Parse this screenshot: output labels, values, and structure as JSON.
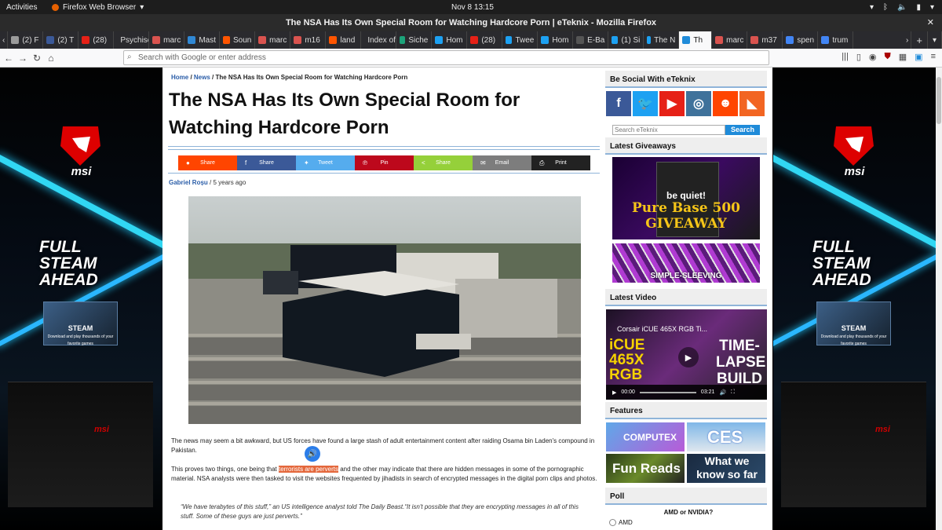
{
  "system_bar": {
    "activities": "Activities",
    "app_menu": "Firefox Web Browser",
    "clock": "Nov 8  13:15"
  },
  "window": {
    "title": "The NSA Has Its Own Special Room for Watching Hardcore Porn | eTeknix - Mozilla Firefox"
  },
  "tabs": [
    {
      "label": "(2) F",
      "color": "#9b9b9b"
    },
    {
      "label": "(2) T",
      "color": "#3b5998"
    },
    {
      "label": "(28)",
      "color": "#e62117"
    },
    {
      "label": "Psychisc",
      "color": "#777777"
    },
    {
      "label": "marc",
      "color": "#d9534f"
    },
    {
      "label": "Mast",
      "color": "#3088d4"
    },
    {
      "label": "Soun",
      "color": "#ff5500"
    },
    {
      "label": "marc",
      "color": "#d9534f"
    },
    {
      "label": "m16",
      "color": "#d9534f"
    },
    {
      "label": "land",
      "color": "#ff5500"
    },
    {
      "label": "Index of",
      "color": "#777777"
    },
    {
      "label": "Siche",
      "color": "#1ca37a"
    },
    {
      "label": "Hom",
      "color": "#1da1f2"
    },
    {
      "label": "(28)",
      "color": "#e62117"
    },
    {
      "label": "Twee",
      "color": "#1da1f2"
    },
    {
      "label": "Hom",
      "color": "#1da1f2"
    },
    {
      "label": "E-Ba",
      "color": "#555555"
    },
    {
      "label": "(1) Si",
      "color": "#1da1f2"
    },
    {
      "label": "The N",
      "color": "#1da1f2"
    },
    {
      "label": "Th",
      "color": "#1f8bd9",
      "active": true
    },
    {
      "label": "marc",
      "color": "#d9534f"
    },
    {
      "label": "m37",
      "color": "#d9534f"
    },
    {
      "label": "spen",
      "color": "#4285f4"
    },
    {
      "label": "trum",
      "color": "#4285f4"
    }
  ],
  "url_bar": {
    "placeholder": "Search with Google or enter address"
  },
  "breadcrumb": {
    "home": "Home",
    "news": "News",
    "current": "The NSA Has Its Own Special Room for Watching Hardcore Porn"
  },
  "article": {
    "title": "The NSA Has Its Own Special Room for Watching Hardcore Porn",
    "author": "Gabriel Roșu",
    "date": "5 years ago",
    "p1": "The news may seem a bit awkward, but US forces have found a large stash of adult entertainment content after raiding Osama bin Laden's compound in Pakistan.",
    "p2_before": "This proves two things, one being that ",
    "p2_highlight": "terrorists are perverts",
    "p2_after": " and the other may indicate that there are hidden messages in some of the pornographic material. NSA analysts were then tasked to visit the websites frequented by jihadists in search of encrypted messages in the digital porn clips and photos.",
    "quote": "“We have terabytes of this stuff,” an US intelligence analyst told The Daily Beast.“It isn't possible that they are encrypting messages in all of this stuff. Some of these guys are just perverts.”"
  },
  "share_buttons": [
    {
      "label": "Share",
      "icon": "reddit-icon",
      "glyph": "●",
      "color": "#ff4500"
    },
    {
      "label": "Share",
      "icon": "facebook-icon",
      "glyph": "f",
      "color": "#3b5998"
    },
    {
      "label": "Tweet",
      "icon": "twitter-icon",
      "glyph": "✦",
      "color": "#55acee"
    },
    {
      "label": "Pin",
      "icon": "pinterest-icon",
      "glyph": "℗",
      "color": "#bd081c"
    },
    {
      "label": "Share",
      "icon": "share-icon",
      "glyph": "<",
      "color": "#95d03a"
    },
    {
      "label": "Email",
      "icon": "email-icon",
      "glyph": "✉",
      "color": "#7d7d7d"
    },
    {
      "label": "Print",
      "icon": "print-icon",
      "glyph": "⎙",
      "color": "#222222"
    }
  ],
  "ads": {
    "brand": "msi",
    "slogan_1": "FULL",
    "slogan_2": "STEAM",
    "slogan_3": "AHEAD",
    "steam_title": "STEAM",
    "steam_sub": "Download and play thousands of your favorite games"
  },
  "sidebar": {
    "social_heading": "Be Social With eTeknix",
    "social": [
      {
        "name": "facebook-icon",
        "glyph": "f",
        "color": "#3b5998"
      },
      {
        "name": "twitter-icon",
        "glyph": "🐦",
        "color": "#1da1f2"
      },
      {
        "name": "youtube-icon",
        "glyph": "▶",
        "color": "#e62117"
      },
      {
        "name": "instagram-icon",
        "glyph": "◎",
        "color": "#3f729b"
      },
      {
        "name": "reddit-icon",
        "glyph": "☻",
        "color": "#ff4500"
      },
      {
        "name": "rss-icon",
        "glyph": "◣",
        "color": "#f26522"
      }
    ],
    "search_placeholder": "Search eTeknix",
    "search_button": "Search",
    "giveaways_heading": "Latest Giveaways",
    "giveaway_1_line1": "be quiet!",
    "giveaway_1_line2": "Pure Base 500",
    "giveaway_1_line3": "GIVEAWAY",
    "giveaway_2": "SIMPLE-SLEEVING",
    "video_heading": "Latest Video",
    "video_title": "Corsair iCUE 465X RGB Ti...",
    "video_overlay_1": "iCUE",
    "video_overlay_2": "465X",
    "video_overlay_3": "RGB",
    "video_overlay_right": "TIME-LAPSE BUILD",
    "video_time": "00:00",
    "video_duration": "03:21",
    "features_heading": "Features",
    "feature_1": "COMPUTEX",
    "feature_2": "CES",
    "feature_3": "Fun Reads",
    "feature_4": "What we know so far",
    "poll_heading": "Poll",
    "poll_question": "AMD or NVIDIA?",
    "poll_option_1": "AMD"
  }
}
